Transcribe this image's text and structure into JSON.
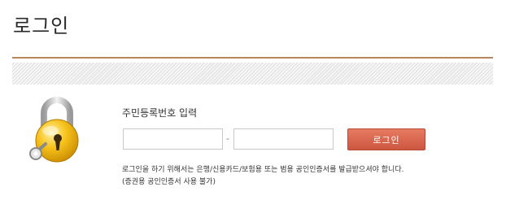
{
  "page": {
    "title": "로그인"
  },
  "icons": {
    "lock": "padlock-with-key-icon"
  },
  "login_form": {
    "label": "주민등록번호 입력",
    "field1_value": "",
    "field2_value": "",
    "separator": "-",
    "button_label": "로그인"
  },
  "notice": {
    "line1": "로그인을 하기 위해서는 은행/신용카드/보험용 또는 범용 공인인증서를 발급받으셔야 합니다.",
    "line2": "(증권용 공인인증서 사용 불가)"
  },
  "colors": {
    "accent_rule": "#b9855a",
    "button": "#d9634b",
    "lock_gold": "#f2b700"
  }
}
